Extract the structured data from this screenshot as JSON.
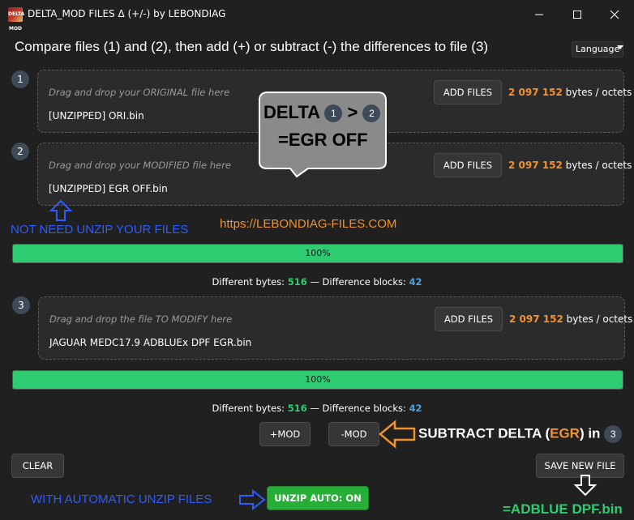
{
  "window": {
    "title": "DELTA_MOD FILES Δ (+/-) by LEBONDIAG",
    "icon_label": "DELTA MOD",
    "minimize_icon": "minimize-icon",
    "maximize_icon": "maximize-icon",
    "close_icon": "close-icon"
  },
  "header": {
    "instruction": "Compare files (1) and (2), then add (+) or subtract (-) the differences to file (3)",
    "language_label": "Language"
  },
  "file1": {
    "step": "1",
    "hint": "Drag and drop your ORIGINAL file here",
    "file": "[UNZIPPED] ORI.bin",
    "button": "ADD FILES",
    "size_num": "2 097 152",
    "size_unit": "bytes / octets"
  },
  "file2": {
    "step": "2",
    "hint": "Drag and drop your MODIFIED file here",
    "file": "[UNZIPPED] EGR OFF.bin",
    "button": "ADD FILES",
    "size_num": "2 097 152",
    "size_unit": "bytes / octets"
  },
  "file3": {
    "step": "3",
    "hint": "Drag and drop the file TO MODIFY here",
    "file": "JAGUAR  MEDC17.9 ADBLUEx DPF EGR.bin",
    "button": "ADD FILES",
    "size_num": "2 097 152",
    "size_unit": "bytes / octets"
  },
  "progress1": {
    "label": "100%",
    "value": 1.0
  },
  "stats1": {
    "diff_label": "Different bytes: ",
    "diff_value": "516",
    "sep": " — Difference blocks: ",
    "blocks_value": "42"
  },
  "progress2": {
    "label": "100%",
    "value": 1.0
  },
  "stats2": {
    "diff_label": "Different bytes: ",
    "diff_value": "516",
    "sep": " — Difference blocks: ",
    "blocks_value": "42"
  },
  "actions": {
    "plus_mod": "+MOD",
    "minus_mod": "-MOD",
    "clear": "CLEAR",
    "save": "SAVE NEW FILE",
    "unzip": "UNZIP AUTO: ON"
  },
  "annotations": {
    "bubble_delta": "DELTA",
    "bubble_one": "1",
    "bubble_gt": ">",
    "bubble_two": "2",
    "bubble_result": "=EGR OFF",
    "no_unzip": "NOT NEED UNZIP YOUR FILES",
    "website": "https://LEBONDIAG-FILES.COM",
    "subtract_pre": "SUBTRACT DELTA (",
    "subtract_egr": "EGR",
    "subtract_post": ") in",
    "subtract_step": "3",
    "auto_unzip": "WITH AUTOMATIC UNZIP FILES",
    "result_file": "=ADBLUE DPF.bin"
  },
  "colors": {
    "accent_orange": "#f0922e",
    "progress_green": "#2ecc71",
    "annotation_blue": "#2f5bff",
    "unzip_green": "#27ae37"
  }
}
